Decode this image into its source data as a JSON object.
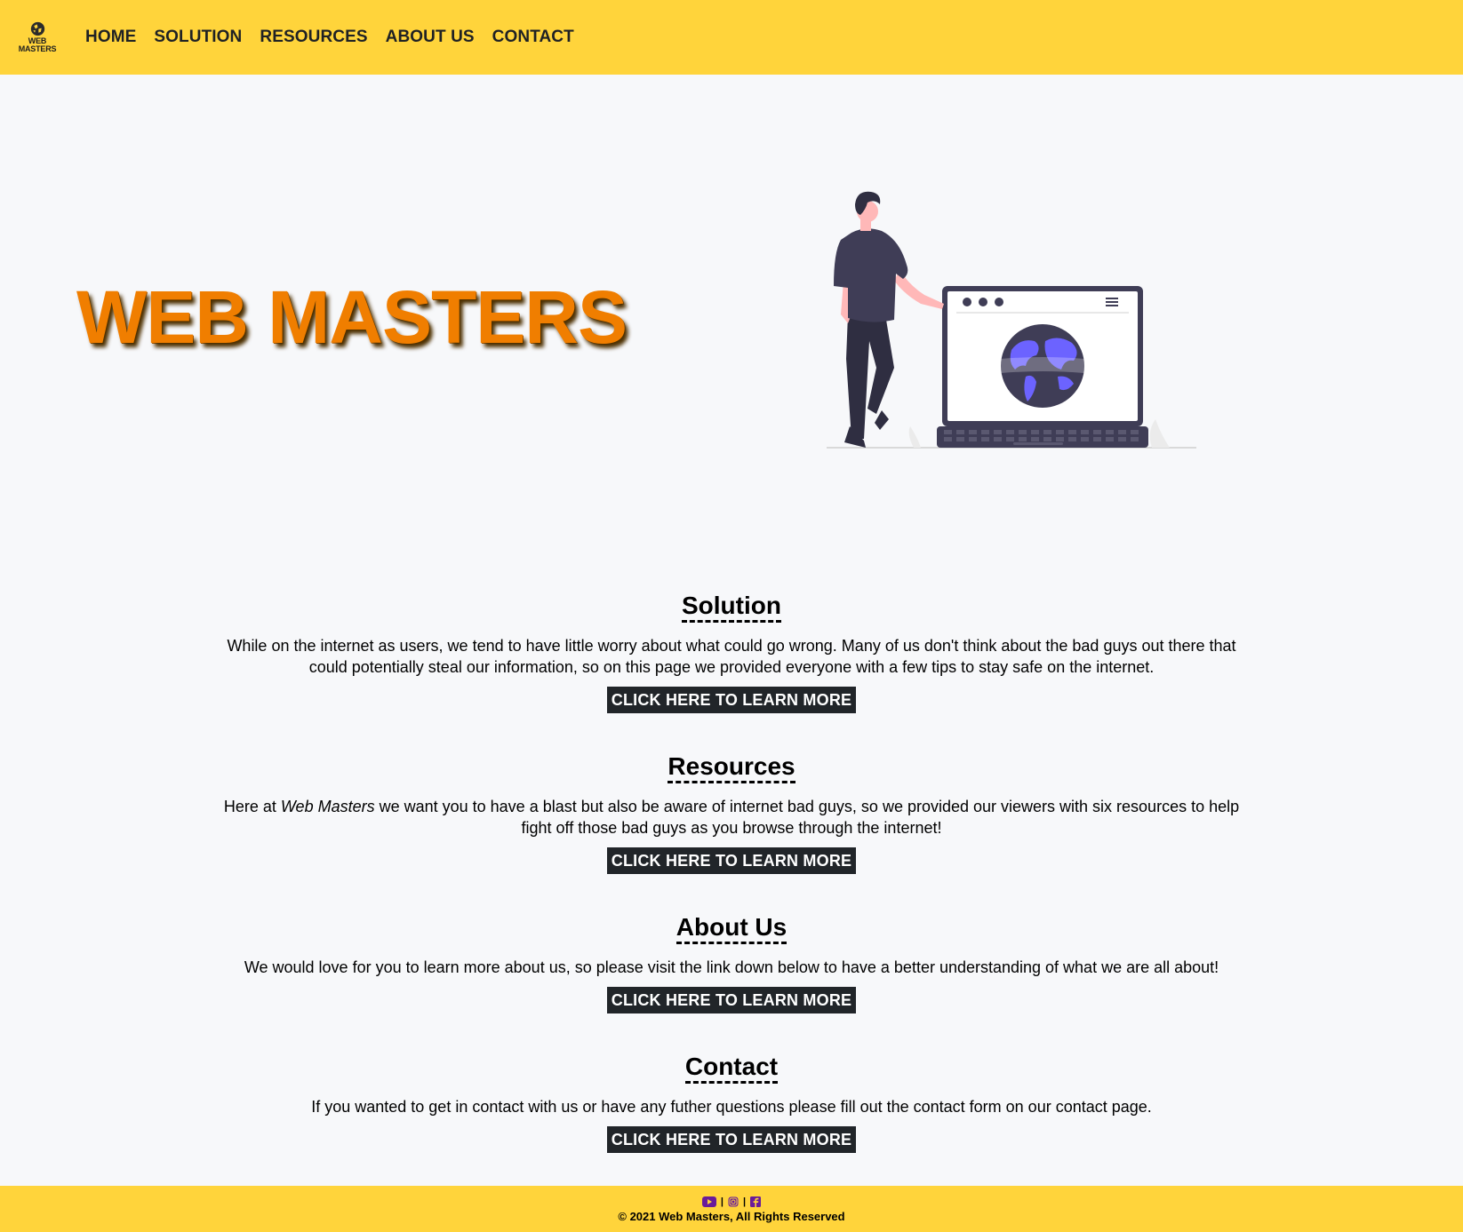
{
  "brand": {
    "logo_text_line1": "WEB",
    "logo_text_line2": "MASTERS",
    "primary_color": "#ffd43b",
    "accent_color": "#f07e00"
  },
  "nav": {
    "items": [
      {
        "label": "HOME"
      },
      {
        "label": "SOLUTION"
      },
      {
        "label": "RESOURCES"
      },
      {
        "label": "ABOUT US"
      },
      {
        "label": "CONTACT"
      }
    ]
  },
  "hero": {
    "title": "WEB MASTERS",
    "illustration": "person-with-laptop-globe-illustration"
  },
  "sections": [
    {
      "title": "Solution",
      "text": "While on the internet as users, we tend to have little worry about what could go wrong. Many of us don't think about the bad guys out there that could potentially steal our information, so on this page we provided everyone with a few tips to stay safe on the internet.",
      "button": "CLICK HERE TO LEARN MORE"
    },
    {
      "title": "Resources",
      "text_prefix": "Here at ",
      "text_emphasis": "Web Masters",
      "text_suffix": " we want you to have a blast but also be aware of internet bad guys, so we provided our viewers with six resources to help fight off those bad guys as you browse through the internet!",
      "button": "CLICK HERE TO LEARN MORE"
    },
    {
      "title": "About Us",
      "text": "We would love for you to learn more about us, so please visit the link down below to have a better understanding of what we are all about!",
      "button": "CLICK HERE TO LEARN MORE"
    },
    {
      "title": "Contact",
      "text": "If you wanted to get in contact with us or have any futher questions please fill out the contact form on our contact page.",
      "button": "CLICK HERE TO LEARN MORE"
    }
  ],
  "footer": {
    "social_icons": [
      "youtube-icon",
      "instagram-icon",
      "facebook-icon"
    ],
    "separator": "|",
    "social_color": "#6a1b9a",
    "copyright": "© 2021 Web Masters, All Rights Reserved"
  }
}
